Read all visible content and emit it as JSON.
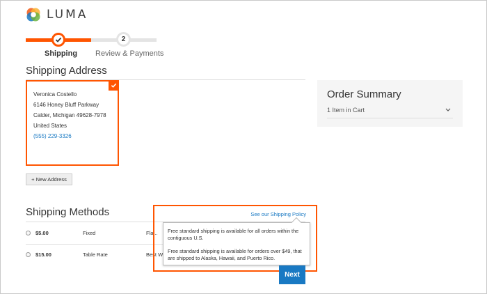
{
  "brand": {
    "name": "LUMA",
    "accent": "#ff5501",
    "link": "#1979c3"
  },
  "progress": {
    "steps": [
      {
        "number": "1",
        "label": "Shipping",
        "state": "complete"
      },
      {
        "number": "2",
        "label": "Review & Payments",
        "state": "pending"
      }
    ]
  },
  "shipping_address": {
    "title": "Shipping Address",
    "card": {
      "name": "Veronica Costello",
      "street": "6146 Honey Bluff Parkway",
      "city_line": "Calder, Michigan 49628-7978",
      "country": "United States",
      "phone": "(555) 229-3326",
      "selected": true
    },
    "new_address_label": "+ New Address"
  },
  "order_summary": {
    "title": "Order Summary",
    "items_label": "1 Item in Cart",
    "chevron_icon": "chevron-down-icon"
  },
  "shipping_methods": {
    "title": "Shipping Methods",
    "rows": [
      {
        "price": "$5.00",
        "type": "Fixed",
        "carrier": "Fla..."
      },
      {
        "price": "$15.00",
        "type": "Table Rate",
        "carrier": "Best W..."
      }
    ],
    "policy_link": "See our Shipping Policy",
    "tooltip": {
      "paragraph1": "Free standard shipping is available for all orders within the contiguous U.S.",
      "paragraph2": "Free standard shipping is available for orders over $49, that are shipped to Alaska, Hawaii, and Puerto Rico."
    }
  },
  "actions": {
    "next_label": "Next"
  }
}
